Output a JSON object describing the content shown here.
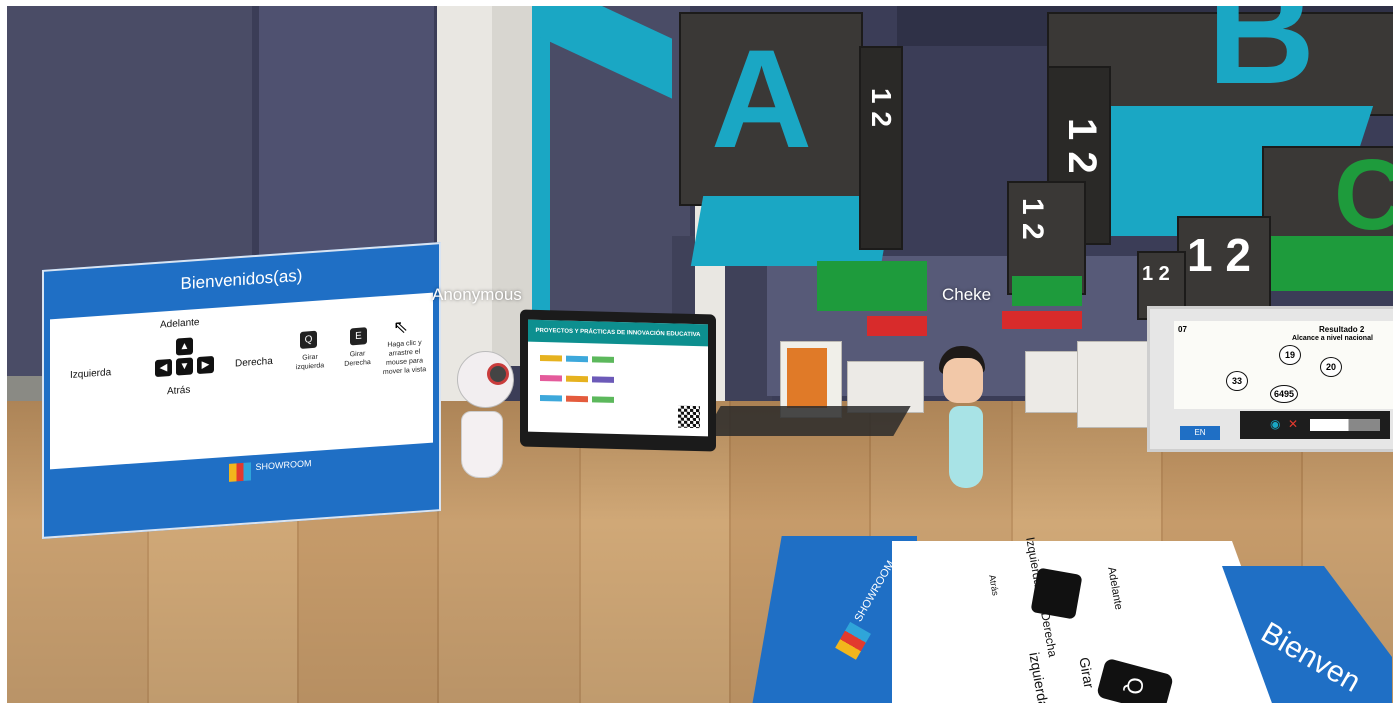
{
  "avatars": {
    "left_name": "Anonymous",
    "right_name": "Cheke"
  },
  "cubes": {
    "letter_a": "A",
    "letter_b": "B",
    "number_row": "1 2",
    "letter_c": "C"
  },
  "welcome_panel": {
    "title": "Bienvenidos(as)",
    "forward": "Adelante",
    "back": "Atrás",
    "left": "Izquierda",
    "right": "Derecha",
    "key_q": "Q",
    "key_e": "E",
    "q_label": "Girar izquierda",
    "e_label": "Girar Derecha",
    "mouse_hint": "Haga clic y arrastre el mouse para mover la vista",
    "logo": "SHOWROOM"
  },
  "board": {
    "header": "PROYECTOS Y PRÁCTICAS DE INNOVACIÓN EDUCATIVA"
  },
  "right_screen": {
    "number": "07",
    "title": "Resultado 2",
    "subtitle": "Alcance a nivel nacional",
    "bubbles": [
      "19",
      "20",
      "33",
      "6495"
    ],
    "lang_button": "EN"
  },
  "floor_panel": {
    "title_partial": "Bienven",
    "forward": "Adelante",
    "right": "Derecha",
    "left_partial": "Izquierda",
    "back_partial": "Atrás",
    "turn": "Girar",
    "turn_left": "izquierda",
    "key_q": "Q",
    "logo": "SHOWROOM"
  },
  "colors": {
    "cube_accent": "#1aa7c4",
    "panel_blue": "#1f6fc5",
    "floor": "#c9a070",
    "wall": "#45475f"
  }
}
